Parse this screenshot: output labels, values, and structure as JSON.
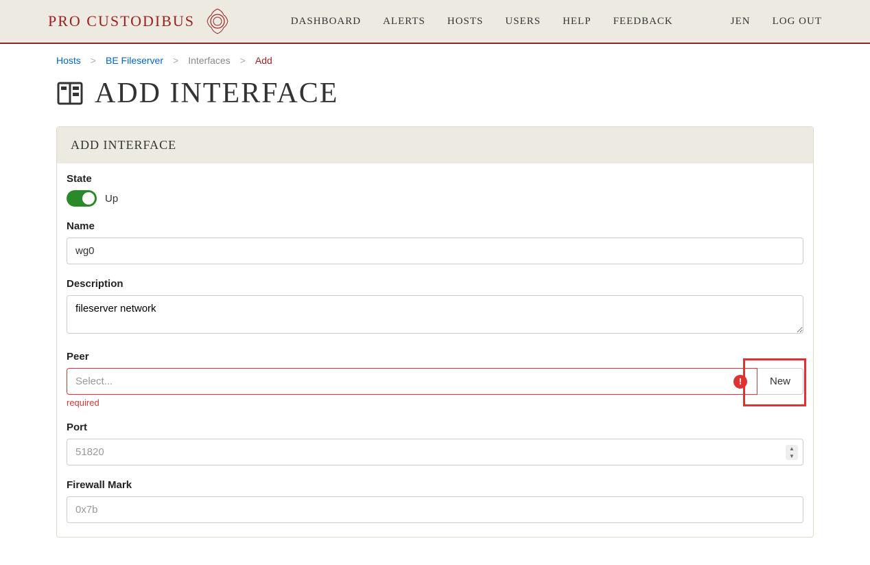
{
  "header": {
    "brand": "PRO CUSTODIBUS",
    "nav": {
      "dashboard": "DASHBOARD",
      "alerts": "ALERTS",
      "hosts": "HOSTS",
      "users": "USERS",
      "help": "HELP",
      "feedback": "FEEDBACK",
      "user": "JEN",
      "logout": "LOG OUT"
    }
  },
  "breadcrumbs": {
    "hosts": "Hosts",
    "be_fileserver": "BE Fileserver",
    "interfaces": "Interfaces",
    "add": "Add",
    "sep": ">"
  },
  "page": {
    "title": "ADD INTERFACE"
  },
  "panel": {
    "title": "ADD INTERFACE"
  },
  "form": {
    "state": {
      "label": "State",
      "value": "Up"
    },
    "name": {
      "label": "Name",
      "value": "wg0"
    },
    "description": {
      "label": "Description",
      "value": "fileserver network"
    },
    "peer": {
      "label": "Peer",
      "placeholder": "Select...",
      "new_button": "New",
      "error": "required",
      "error_badge": "!"
    },
    "port": {
      "label": "Port",
      "placeholder": "51820"
    },
    "firewall_mark": {
      "label": "Firewall Mark",
      "placeholder": "0x7b"
    }
  }
}
